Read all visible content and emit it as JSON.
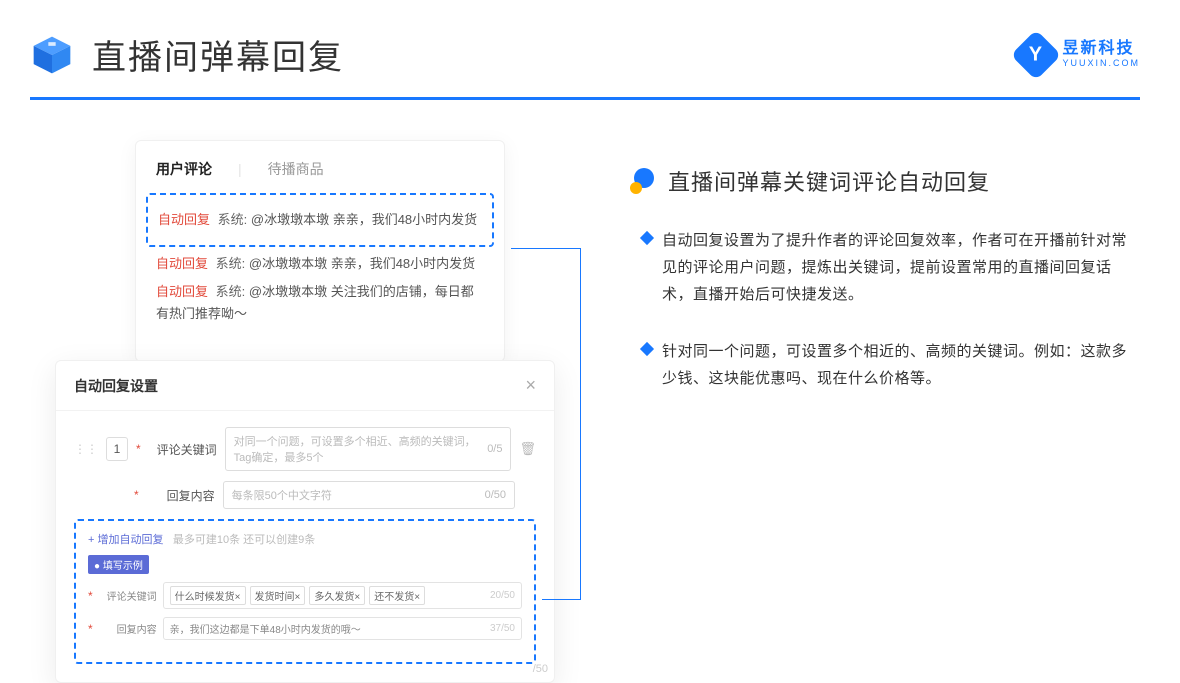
{
  "header": {
    "title": "直播间弹幕回复",
    "brand_cn": "昱新科技",
    "brand_en": "YUUXIN.COM",
    "brand_letter": "Y"
  },
  "card1": {
    "tab_active": "用户评论",
    "tab_inactive": "待播商品",
    "row1_auto": "自动回复",
    "row1_sys": "系统:",
    "row1_text": "@冰墩墩本墩 亲亲，我们48小时内发货",
    "row2_auto": "自动回复",
    "row2_sys": "系统:",
    "row2_text": "@冰墩墩本墩 亲亲，我们48小时内发货",
    "row3_auto": "自动回复",
    "row3_sys": "系统:",
    "row3_text": "@冰墩墩本墩 关注我们的店铺，每日都有热门推荐呦～"
  },
  "card2": {
    "title": "自动回复设置",
    "num": "1",
    "label_kw": "评论关键词",
    "placeholder_kw": "对同一个问题，可设置多个相近、高频的关键词，Tag确定，最多5个",
    "count_kw": "0/5",
    "label_reply": "回复内容",
    "placeholder_reply": "每条限50个中文字符",
    "count_reply": "0/50",
    "add_link": "+ 增加自动回复",
    "add_hint": "最多可建10条 还可以创建9条",
    "example_badge": "● 填写示例",
    "ex_label_kw": "评论关键词",
    "ex_tags": [
      "什么时候发货×",
      "发货时间×",
      "多久发货×",
      "还不发货×"
    ],
    "ex_kw_count": "20/50",
    "ex_label_reply": "回复内容",
    "ex_reply_text": "亲，我们这边都是下单48小时内发货的哦～",
    "ex_reply_count": "37/50",
    "outer_count": "/50"
  },
  "right": {
    "heading": "直播间弹幕关键词评论自动回复",
    "p1": "自动回复设置为了提升作者的评论回复效率，作者可在开播前针对常见的评论用户问题，提炼出关键词，提前设置常用的直播间回复话术，直播开始后可快捷发送。",
    "p2": "针对同一个问题，可设置多个相近的、高频的关键词。例如：这款多少钱、这块能优惠吗、现在什么价格等。"
  }
}
